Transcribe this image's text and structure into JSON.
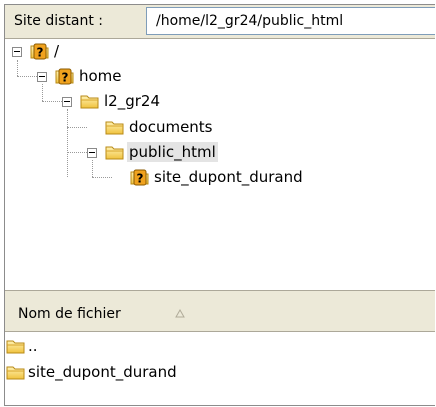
{
  "address": {
    "label": "Site distant :",
    "path": "/home/l2_gr24/public_html"
  },
  "tree": {
    "nodes": [
      {
        "label": "/",
        "icon": "unknown-folder-icon"
      },
      {
        "label": "home",
        "icon": "unknown-folder-icon"
      },
      {
        "label": "l2_gr24",
        "icon": "folder-icon"
      },
      {
        "label": "documents",
        "icon": "folder-icon"
      },
      {
        "label": "public_html",
        "icon": "folder-icon",
        "selected": true
      },
      {
        "label": "site_dupont_durand",
        "icon": "unknown-folder-icon"
      }
    ]
  },
  "list": {
    "column_header": "Nom de fichier",
    "sort_icon": "sort-ascending-icon",
    "rows": [
      {
        "label": "..",
        "icon": "folder-icon"
      },
      {
        "label": "site_dupont_durand",
        "icon": "folder-icon"
      }
    ]
  },
  "colors": {
    "folder": "#f3c94a",
    "unknown_badge": "#e89a1c",
    "chrome": "#ece9d8"
  }
}
